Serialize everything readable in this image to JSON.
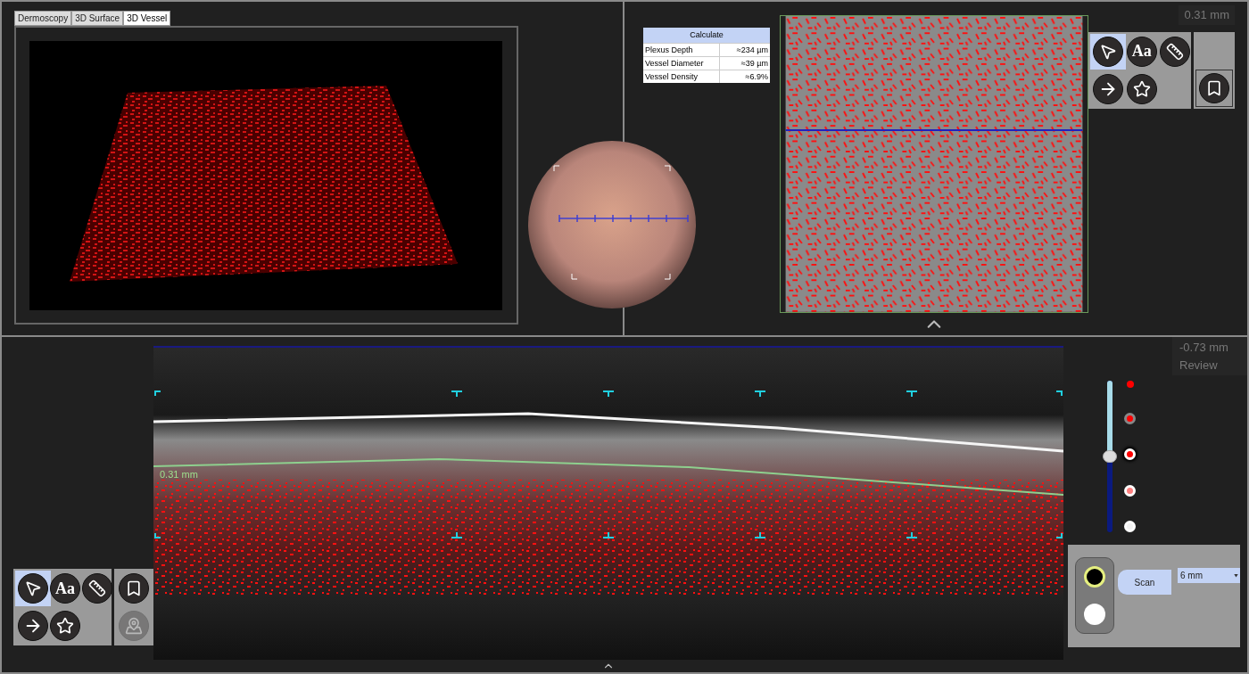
{
  "view_tabs": [
    {
      "label": "Dermoscopy",
      "selected": false
    },
    {
      "label": "3D Surface",
      "selected": false
    },
    {
      "label": "3D Vessel",
      "selected": true
    }
  ],
  "calculate_table": {
    "title": "Calculate",
    "rows": [
      {
        "name": "Plexus Depth",
        "value": "≈234 µm"
      },
      {
        "name": "Vessel Diameter",
        "value": "≈39 µm"
      },
      {
        "name": "Vessel Density",
        "value": "≈6.9%"
      }
    ]
  },
  "en_face": {
    "depth": "0.31 mm"
  },
  "top_toolbar": {
    "tools": [
      {
        "kind": "pointer",
        "selected": true
      },
      {
        "kind": "text",
        "label": "Aa",
        "selected": false
      },
      {
        "kind": "ruler",
        "selected": false
      },
      {
        "kind": "arrow",
        "selected": false
      },
      {
        "kind": "star",
        "selected": false
      }
    ],
    "side_tools": [
      {
        "kind": "bookmark",
        "disabled": false
      }
    ]
  },
  "b_scan": {
    "depth": "-0.73 mm",
    "mode": "Review",
    "layer_label": "0.31 mm"
  },
  "depth_slider": {
    "level": 0.5
  },
  "depth_dots": [
    {
      "kind": "plain",
      "color": "#ff0000",
      "selected": false
    },
    {
      "kind": "grey_ring",
      "color": "#ff0000",
      "selected": false
    },
    {
      "kind": "white_ring",
      "color": "#ff0000",
      "selected": true
    },
    {
      "kind": "white_ring",
      "color": "#ff8080",
      "selected": false
    },
    {
      "kind": "white_ring",
      "color": "#f2f2f2",
      "selected": false
    }
  ],
  "scan_panel": {
    "modes": [
      {
        "kind": "dark",
        "selected": true
      },
      {
        "kind": "light",
        "selected": false
      }
    ],
    "button": "Scan",
    "size": "6 mm"
  },
  "bottom_toolbar": {
    "tools": [
      {
        "kind": "pointer",
        "selected": true
      },
      {
        "kind": "text",
        "label": "Aa",
        "selected": false
      },
      {
        "kind": "ruler",
        "selected": false
      },
      {
        "kind": "arrow",
        "selected": false
      },
      {
        "kind": "star",
        "selected": false
      }
    ],
    "side_tools": [
      {
        "kind": "bookmark",
        "disabled": false
      },
      {
        "kind": "map",
        "disabled": true
      }
    ]
  }
}
